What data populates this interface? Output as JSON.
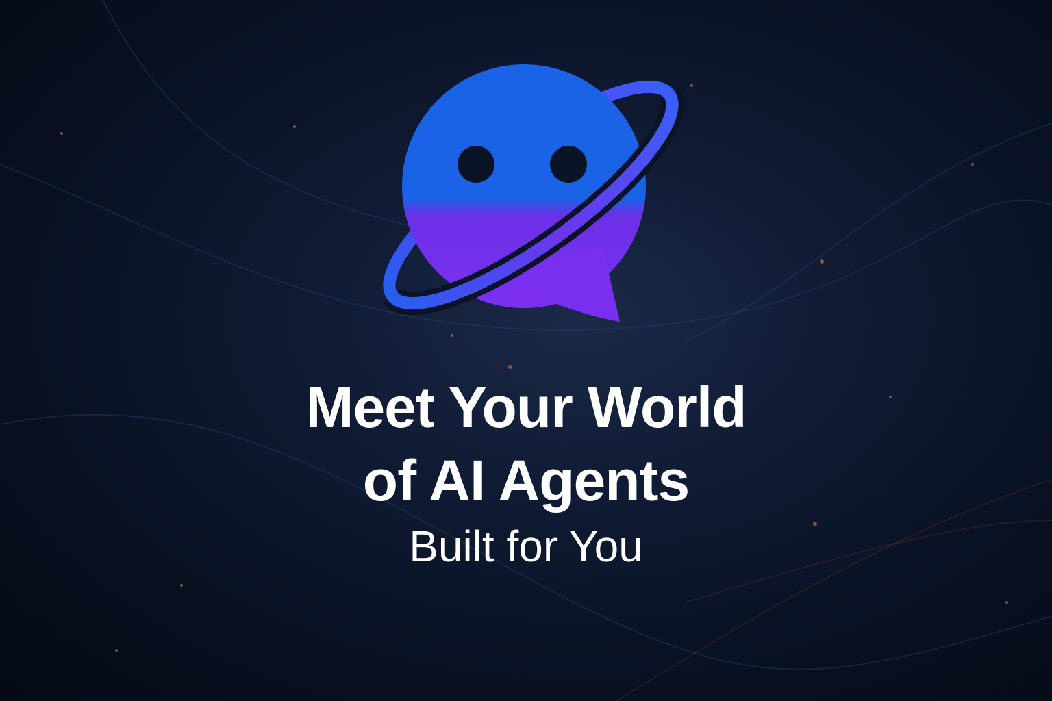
{
  "headline": {
    "line1": "Meet Your World",
    "line2": "of AI Agents"
  },
  "subheadline": "Built for You",
  "logo": {
    "icon": "chat-bubble-planet-icon",
    "colors": {
      "blue": "#1a63e6",
      "purple": "#7a2ff0",
      "ring_blue": "#2f63f5"
    }
  },
  "background_color": "#0a1326"
}
